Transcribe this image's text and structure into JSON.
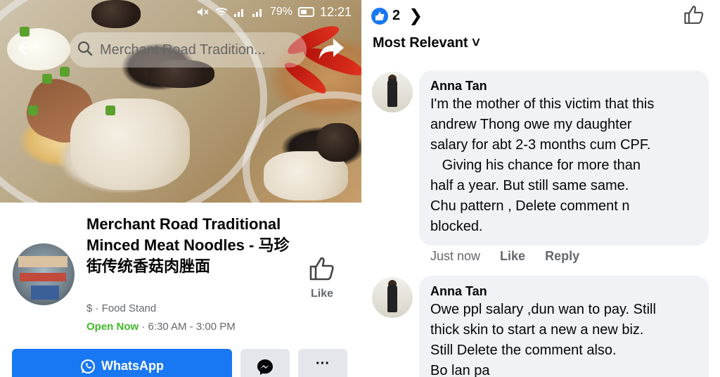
{
  "status_bar": {
    "battery": "79%",
    "time": "12:21"
  },
  "header": {
    "search_text": "Merchant Road Tradition..."
  },
  "page": {
    "title": "Merchant Road Traditional Minced Meat Noodles - 马珍街传统香菇肉脞面",
    "category": "$ · Food Stand",
    "open_status": "Open Now",
    "hours": " · 6:30 AM - 3:00 PM",
    "like_label": "Like"
  },
  "buttons": {
    "whatsapp": "WhatsApp",
    "more": "···"
  },
  "reactions": {
    "count": "2",
    "chevron": "❯"
  },
  "sort_label": "Most Relevant ˅",
  "comments": [
    {
      "author": "Anna Tan",
      "text": "I'm the mother of this victim that this\nandrew Thong owe my daughter\nsalary for abt 2-3 months cum CPF.\n   Giving his chance for more than\nhalf a year. But still same same.\nChu pattern , Delete comment n\nblocked.",
      "time": "Just now",
      "like": "Like",
      "reply": "Reply"
    },
    {
      "author": "Anna Tan",
      "text": "Owe ppl salary ,dun wan to pay. Still\nthick skin to start a new a new biz.\nStill Delete the comment also.\nBo lan pa"
    }
  ],
  "colors": {
    "fb_blue": "#1877f2",
    "open_green": "#42b72a",
    "bubble_gray": "#f0f2f5"
  }
}
